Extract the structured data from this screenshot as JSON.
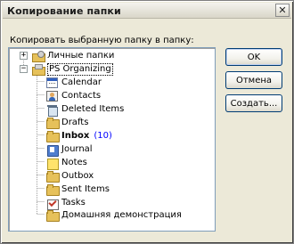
{
  "window": {
    "title": "Копирование папки",
    "close_symbol": "✕"
  },
  "prompt": "Копировать выбранную папку в папку:",
  "tree": {
    "items": [
      {
        "label": "Личные папки",
        "icon": "personal-folders-icon",
        "expander": "+"
      },
      {
        "label": "PS Organizing",
        "icon": "mailbox-icon",
        "expander": "−"
      },
      {
        "label": "Calendar",
        "icon": "calendar-icon"
      },
      {
        "label": "Contacts",
        "icon": "contacts-icon"
      },
      {
        "label": "Deleted Items",
        "icon": "deleted-items-icon"
      },
      {
        "label": "Drafts",
        "icon": "folder-icon"
      },
      {
        "label": "Inbox",
        "icon": "folder-icon",
        "count": "(10)"
      },
      {
        "label": "Journal",
        "icon": "journal-icon"
      },
      {
        "label": "Notes",
        "icon": "notes-icon"
      },
      {
        "label": "Outbox",
        "icon": "folder-icon"
      },
      {
        "label": "Sent Items",
        "icon": "folder-icon"
      },
      {
        "label": "Tasks",
        "icon": "tasks-icon"
      },
      {
        "label": "Домашняя демонстрация",
        "icon": "folder-icon"
      }
    ]
  },
  "buttons": {
    "ok": "OK",
    "cancel": "Отмена",
    "create": "Создать..."
  }
}
